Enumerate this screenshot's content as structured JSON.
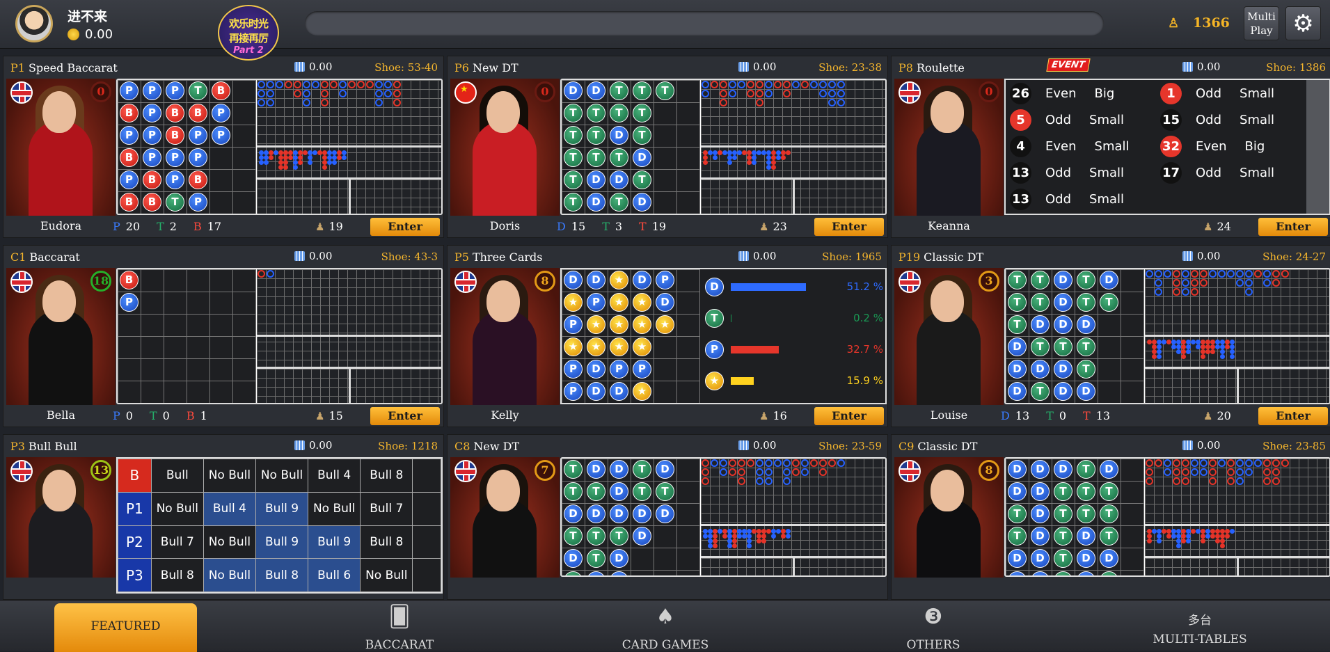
{
  "topbar": {
    "username": "进不来",
    "balance": "0.00",
    "logo_line1": "欢乐时光",
    "logo_line2": "再接再厉",
    "logo_line3": "Part 2",
    "online_count": "1366",
    "multiplay_line1": "Multi",
    "multiplay_line2": "Play"
  },
  "tables": [
    {
      "id": "P1",
      "name": "Speed Baccarat",
      "pool": "0.00",
      "shoe": "Shoe: 53-40",
      "dealer": "Eudora",
      "flag": "uk",
      "timer": "0",
      "stats": {
        "p": "20",
        "t": "2",
        "b": "17"
      },
      "players": "19",
      "enter": "Enter",
      "bead": [
        [
          "P",
          "B",
          "P",
          "B",
          "P",
          "B"
        ],
        [
          "P",
          "P",
          ".P",
          "P",
          "B",
          "B"
        ],
        [
          "P",
          "B",
          "B",
          "P",
          "P",
          "T"
        ],
        [
          "T",
          "B",
          "P",
          "P",
          "B",
          "P"
        ],
        [
          "B",
          "P",
          "P",
          "",
          " ",
          ""
        ]
      ]
    },
    {
      "id": "P6",
      "name": "New DT",
      "pool": "0.00",
      "shoe": "Shoe: 23-38",
      "dealer": "Doris",
      "flag": "cn",
      "timer": "0",
      "stats": {
        "d": "15",
        "t": "3",
        "tg": "19"
      },
      "players": "23",
      "enter": "Enter",
      "bead": [
        [
          "D",
          "T",
          "T",
          "T",
          "T",
          "T"
        ],
        [
          "D",
          "T",
          "T",
          "T",
          "D",
          "D"
        ],
        [
          "T",
          "T",
          "D",
          "T",
          "D",
          "T"
        ],
        [
          "T",
          "T",
          "T",
          "D",
          "T",
          "D"
        ],
        [
          "T",
          "",
          "",
          "",
          "",
          ""
        ]
      ]
    },
    {
      "id": "P8",
      "name": "Roulette",
      "event": "EVENT",
      "pool": "0.00",
      "shoe": "Shoe: 1386",
      "dealer": "Keanna",
      "flag": "uk",
      "timer": "0",
      "players": "24",
      "enter": "Enter",
      "results": [
        {
          "n": "26",
          "c": "black",
          "eo": "Even",
          "bs": "Big"
        },
        {
          "n": "5",
          "c": "red",
          "eo": "Odd",
          "bs": "Small"
        },
        {
          "n": "4",
          "c": "black",
          "eo": "Even",
          "bs": "Small"
        },
        {
          "n": "13",
          "c": "black",
          "eo": "Odd",
          "bs": "Small"
        },
        {
          "n": "13",
          "c": "black",
          "eo": "Odd",
          "bs": "Small"
        },
        {
          "n": "1",
          "c": "red",
          "eo": "Odd",
          "bs": "Small"
        },
        {
          "n": "15",
          "c": "black",
          "eo": "Odd",
          "bs": "Small"
        },
        {
          "n": "32",
          "c": "red",
          "eo": "Even",
          "bs": "Big"
        },
        {
          "n": "17",
          "c": "black",
          "eo": "Odd",
          "bs": "Small"
        }
      ]
    },
    {
      "id": "C1",
      "name": "Baccarat",
      "pool": "0.00",
      "shoe": "Shoe: 43-3",
      "dealer": "Bella",
      "flag": "uk",
      "timer": "18",
      "stats": {
        "p": "0",
        "t": "0",
        "b": "1"
      },
      "players": "15",
      "enter": "Enter",
      "bead": [
        [
          "B",
          "P"
        ]
      ]
    },
    {
      "id": "P5",
      "name": "Three Cards",
      "pool": "0.00",
      "shoe": "Shoe: 1965",
      "dealer": "Kelly",
      "flag": "uk",
      "timer": "8",
      "players": "16",
      "enter": "Enter",
      "bead": [
        [
          "D",
          "S",
          "P",
          "S",
          "P",
          "P"
        ],
        [
          "D",
          "P",
          "S",
          "S",
          "D",
          "D"
        ],
        [
          "S",
          "S",
          "S",
          "S",
          "P",
          "D"
        ],
        [
          "D",
          "S",
          "S",
          "S",
          "P",
          "S"
        ],
        [
          "P",
          "D",
          "S",
          "",
          "",
          ""
        ]
      ],
      "odds": [
        {
          "label": "D",
          "pct": "51.2 %",
          "v": 51.2,
          "color": "#2e6bff"
        },
        {
          "label": "T",
          "pct": "0.2 %",
          "v": 0.2,
          "color": "#1a9b55"
        },
        {
          "label": "P",
          "pct": "32.7 %",
          "v": 32.7,
          "color": "#e6362b"
        },
        {
          "label": "S",
          "pct": "15.9 %",
          "v": 15.9,
          "color": "#ffd21f"
        }
      ]
    },
    {
      "id": "P19",
      "name": "Classic DT",
      "pool": "0.00",
      "shoe": "Shoe: 24-27",
      "dealer": "Louise",
      "flag": "uk",
      "timer": "3",
      "stats": {
        "d": "13",
        "t": "0",
        "tg": "13"
      },
      "players": "20",
      "enter": "Enter",
      "bead": [
        [
          "T",
          "T",
          "T",
          "D",
          "D",
          "D"
        ],
        [
          "T",
          "T",
          "D",
          "T",
          "D",
          "T"
        ],
        [
          "D",
          "D",
          "D",
          "T",
          "D",
          "D"
        ],
        [
          "T",
          "T",
          "D",
          "T",
          "T",
          "D"
        ],
        [
          "D",
          "T",
          "",
          "",
          "",
          ""
        ]
      ]
    },
    {
      "id": "P3",
      "name": "Bull Bull",
      "pool": "0.00",
      "shoe": "Shoe: 1218",
      "dealer": "",
      "flag": "uk",
      "timer": "13",
      "rows": [
        {
          "k": "B",
          "cells": [
            "Bull",
            "No Bull",
            "No Bull",
            "Bull 4",
            "Bull 8"
          ],
          "hl": [
            false,
            false,
            false,
            false,
            false
          ]
        },
        {
          "k": "P1",
          "cells": [
            "No Bull",
            "Bull 4",
            "Bull 9",
            "No Bull",
            "Bull 7"
          ],
          "hl": [
            false,
            true,
            true,
            false,
            false
          ]
        },
        {
          "k": "P2",
          "cells": [
            "Bull 7",
            "No Bull",
            "Bull 9",
            "Bull 9",
            "Bull 8"
          ],
          "hl": [
            false,
            false,
            true,
            true,
            false
          ]
        },
        {
          "k": "P3",
          "cells": [
            "Bull 8",
            "No Bull",
            "Bull 8",
            "Bull 6",
            "No Bull"
          ],
          "hl": [
            false,
            true,
            true,
            true,
            false
          ]
        }
      ]
    },
    {
      "id": "C8",
      "name": "New DT",
      "pool": "0.00",
      "shoe": "Shoe: 23-59",
      "dealer": "",
      "flag": "uk",
      "timer": "7",
      "bead": [
        [
          "T",
          "T",
          "D",
          "T",
          "D",
          "T"
        ],
        [
          "D",
          "T",
          "D",
          "T",
          "T",
          "D"
        ],
        [
          "D",
          "D",
          "D",
          "T",
          "D",
          "D"
        ],
        [
          "T",
          "T",
          "D",
          "D",
          "",
          ""
        ],
        [
          "D",
          "T",
          "D",
          "",
          "",
          ""
        ]
      ]
    },
    {
      "id": "C9",
      "name": "Classic DT",
      "pool": "0.00",
      "shoe": "Shoe: 23-85",
      "dealer": "",
      "flag": "uk",
      "timer": "8",
      "bead": [
        [
          "D",
          "D",
          "T",
          "T",
          "D",
          "D"
        ],
        [
          "D",
          "D",
          "D",
          "D",
          "D",
          "D"
        ],
        [
          "D",
          "T",
          "T",
          "T",
          "T",
          "T"
        ],
        [
          "T",
          "T",
          "T",
          "D",
          "D",
          "D"
        ],
        [
          "D",
          "T",
          "T",
          "T",
          "D",
          "T"
        ]
      ]
    }
  ],
  "nav": {
    "featured": "FEATURED",
    "baccarat": "BACCARAT",
    "cardgames": "CARD GAMES",
    "others": "OTHERS",
    "multi_cn": "多台",
    "multi": "MULTI-TABLES"
  }
}
